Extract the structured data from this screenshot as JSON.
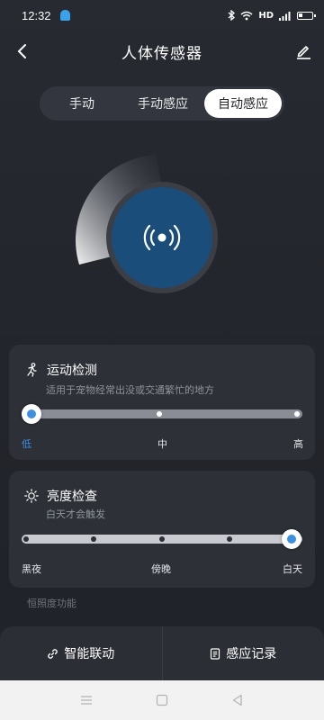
{
  "status_bar": {
    "time": "12:32",
    "network_label": "HD",
    "icons": [
      "notification-bell-icon",
      "bluetooth-icon",
      "wifi-icon",
      "signal-icon",
      "battery-icon"
    ]
  },
  "header": {
    "title": "人体传感器",
    "back_icon": "chevron-left-icon",
    "edit_icon": "edit-pencil-icon"
  },
  "mode_tabs": [
    {
      "label": "手动",
      "active": false
    },
    {
      "label": "手动感应",
      "active": false
    },
    {
      "label": "自动感应",
      "active": true
    }
  ],
  "dial": {
    "icon": "signal-broadcast-icon",
    "accent": "#1b4d7a"
  },
  "motion_detection": {
    "title": "运动检测",
    "subtitle": "适用于宠物经常出没或交通繁忙的地方",
    "levels": [
      "低",
      "中",
      "高"
    ],
    "selected_level": "低",
    "selected_index": 0,
    "step_count": 3
  },
  "brightness_check": {
    "title": "亮度检查",
    "subtitle": "白天才会触发",
    "levels": [
      "黑夜",
      "傍晚",
      "白天"
    ],
    "selected_level": "白天",
    "selected_index": 4,
    "step_count": 5
  },
  "constant_lux": {
    "label": "恒照度功能"
  },
  "bottom_actions": [
    {
      "label": "智能联动",
      "icon": "link-icon"
    },
    {
      "label": "感应记录",
      "icon": "document-icon"
    }
  ],
  "colors": {
    "accent_blue": "#3d8fe0",
    "background": "#23262c",
    "card": "#2d3037"
  }
}
